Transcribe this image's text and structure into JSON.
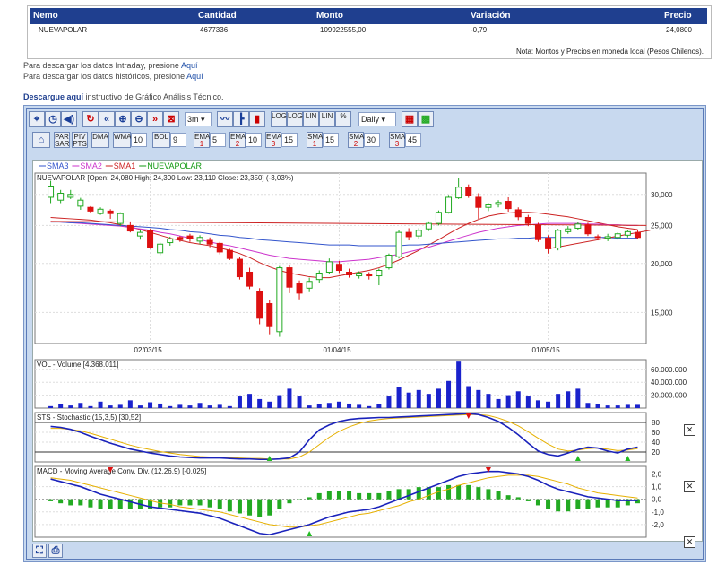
{
  "table": {
    "headers": [
      "Nemo",
      "Cantidad",
      "Monto",
      "Variación",
      "Precio"
    ],
    "row": [
      "NUEVAPOLAR",
      "4677336",
      "109922555,00",
      "-0,79",
      "24,0800"
    ],
    "note": "Nota: Montos y Precios en moneda local (Pesos Chilenos)."
  },
  "links": {
    "intraday_text": "Para descargar los datos Intraday, presione",
    "historic_text": "Para descargar los datos históricos, presione",
    "link_label": "Aquí",
    "technical_prefix": "Descargue aquí",
    "technical_text": "instructivo de Gráfico Análisis Técnico."
  },
  "toolbar": {
    "period": "3m",
    "interval": "Daily",
    "log1": "LOG",
    "log2": "LOG",
    "lin1": "LIN",
    "lin2": "LIN",
    "pct": "%"
  },
  "indicators": {
    "par": "PAR SAR",
    "piv": "PIV PTS",
    "dma": "DMA",
    "wma": "WMA",
    "wma_val": "10",
    "bol": "BOL",
    "bol_val": "9",
    "ema1": "EMA",
    "ema1_n": "1",
    "ema1_val": "5",
    "ema2": "EMA",
    "ema2_n": "2",
    "ema2_val": "10",
    "ema3": "EMA",
    "ema3_n": "3",
    "ema3_val": "15",
    "sma1": "SMA",
    "sma1_n": "1",
    "sma1_val": "15",
    "sma2": "SMA",
    "sma2_n": "2",
    "sma2_val": "30",
    "sma3": "SMA",
    "sma3_n": "3",
    "sma3_val": "45"
  },
  "legend": [
    {
      "label": "SMA3",
      "color": "#3355cc"
    },
    {
      "label": "SMA2",
      "color": "#cc33cc"
    },
    {
      "label": "SMA1",
      "color": "#cc2222"
    },
    {
      "label": "NUEVAPOLAR",
      "color": "#119911"
    }
  ],
  "price_info": "NUEVAPOLAR [Open: 24,080  High: 24,300  Low: 23,110  Close: 23,350] (-3,03%)",
  "volume_label": "VOL - Volume [4.368.011]",
  "stoch_label": "STS - Stochastic (15,3,5) [30,52]",
  "macd_label": "MACD - Moving Average Conv. Div. (12,26,9) [-0,025]",
  "colors": {
    "up": "#22aa22",
    "down": "#dd1111",
    "volume": "#1a22cc",
    "stoch": "#1a22bb",
    "signal": "#e6b000",
    "macd": "#1a22bb"
  },
  "chart_data": [
    {
      "type": "candlestick",
      "title": "NUEVAPOLAR",
      "x_ticks": [
        "02/03/15",
        "01/04/15",
        "01/05/15"
      ],
      "y_ticks": [
        "30,000",
        "25,000",
        "20,000",
        "15,000"
      ],
      "ylim": [
        12.5,
        34
      ],
      "scale": "log",
      "candles": [
        [
          29.5,
          31.5,
          32.5,
          28.5
        ],
        [
          29.0,
          30.2,
          30.8,
          28.5
        ],
        [
          29.5,
          30.0,
          30.8,
          29.2
        ],
        [
          28.0,
          29.0,
          29.4,
          27.4
        ],
        [
          27.8,
          27.2,
          28.0,
          26.9
        ],
        [
          26.8,
          27.5,
          27.8,
          26.6
        ],
        [
          27.2,
          26.8,
          27.5,
          26.0
        ],
        [
          25.3,
          26.8,
          27.0,
          24.9
        ],
        [
          25.0,
          24.2,
          25.6,
          24.0
        ],
        [
          23.5,
          24.0,
          24.3,
          23.0
        ],
        [
          24.3,
          22.0,
          24.5,
          21.8
        ],
        [
          21.3,
          22.4,
          22.6,
          21.0
        ],
        [
          22.6,
          23.1,
          23.4,
          22.2
        ],
        [
          23.3,
          23.0,
          23.5,
          22.7
        ],
        [
          23.5,
          23.1,
          23.8,
          22.7
        ],
        [
          22.8,
          23.3,
          23.6,
          22.4
        ],
        [
          22.9,
          22.4,
          23.3,
          22.0
        ],
        [
          22.5,
          21.4,
          22.7,
          21.1
        ],
        [
          21.6,
          20.6,
          21.8,
          20.4
        ],
        [
          20.5,
          18.5,
          20.8,
          18.2
        ],
        [
          19.0,
          17.5,
          19.5,
          17.2
        ],
        [
          17.0,
          14.5,
          17.3,
          14.0
        ],
        [
          15.8,
          13.8,
          16.1,
          13.2
        ],
        [
          13.4,
          19.5,
          19.7,
          13.0
        ],
        [
          19.5,
          17.4,
          19.8,
          16.8
        ],
        [
          17.8,
          16.8,
          18.1,
          16.2
        ],
        [
          17.3,
          18.0,
          18.4,
          16.9
        ],
        [
          18.2,
          18.9,
          19.2,
          17.8
        ],
        [
          19.0,
          20.2,
          20.6,
          18.8
        ],
        [
          19.9,
          19.2,
          20.3,
          18.9
        ],
        [
          19.0,
          18.7,
          19.4,
          18.4
        ],
        [
          18.6,
          18.9,
          19.1,
          18.3
        ],
        [
          18.8,
          18.6,
          19.0,
          18.2
        ],
        [
          18.6,
          19.2,
          19.4,
          17.6
        ],
        [
          19.5,
          21.0,
          21.2,
          19.3
        ],
        [
          20.8,
          24.0,
          24.4,
          20.6
        ],
        [
          24.0,
          23.4,
          24.6,
          22.9
        ],
        [
          23.5,
          24.3,
          24.6,
          23.1
        ],
        [
          24.5,
          25.3,
          25.6,
          24.2
        ],
        [
          25.3,
          27.0,
          27.3,
          25.0
        ],
        [
          27.0,
          29.5,
          29.9,
          26.8
        ],
        [
          29.4,
          31.3,
          33.0,
          29.2
        ],
        [
          31.2,
          29.8,
          31.8,
          29.4
        ],
        [
          29.5,
          27.8,
          30.2,
          26.0
        ],
        [
          27.8,
          28.2,
          28.5,
          27.2
        ],
        [
          28.3,
          28.6,
          29.0,
          27.8
        ],
        [
          28.8,
          27.6,
          29.5,
          27.1
        ],
        [
          27.4,
          26.3,
          27.8,
          25.8
        ],
        [
          26.2,
          25.3,
          26.6,
          24.9
        ],
        [
          25.0,
          23.0,
          25.4,
          22.7
        ],
        [
          23.2,
          21.8,
          23.6,
          21.2
        ],
        [
          21.9,
          24.3,
          24.5,
          21.6
        ],
        [
          24.1,
          24.5,
          24.9,
          23.8
        ],
        [
          24.6,
          25.2,
          25.5,
          24.3
        ],
        [
          25.1,
          23.8,
          25.4,
          23.5
        ],
        [
          23.4,
          23.3,
          23.7,
          22.9
        ],
        [
          23.2,
          23.4,
          23.8,
          22.8
        ],
        [
          23.3,
          23.8,
          24.0,
          23.0
        ],
        [
          23.6,
          24.1,
          24.4,
          23.3
        ],
        [
          24.0,
          23.3,
          24.3,
          23.1
        ]
      ],
      "series": [
        {
          "name": "SMA1",
          "values": [
            26.2,
            26.1,
            26.0,
            25.9,
            25.8,
            25.6,
            25.4,
            25.1,
            24.8,
            24.4,
            24.0,
            23.6,
            23.2,
            22.9,
            22.6,
            22.4,
            22.2,
            21.9,
            21.6,
            21.2,
            20.7,
            20.1,
            19.6,
            19.2,
            18.9,
            18.7,
            18.5,
            18.4,
            18.4,
            18.6,
            18.8,
            19.0,
            19.2,
            19.5,
            19.9,
            20.4,
            21.0,
            21.6,
            22.3,
            23.0,
            23.8,
            24.6,
            25.3,
            25.9,
            26.4,
            26.7,
            26.9,
            27.0,
            27.0,
            26.9,
            26.7,
            26.5,
            26.3,
            26.0,
            25.7,
            25.4,
            25.1,
            24.8,
            24.6,
            24.4
          ]
        },
        {
          "name": "SMA2",
          "values": [
            25.6,
            25.5,
            25.4,
            25.3,
            25.2,
            25.1,
            25.0,
            24.9,
            24.7,
            24.5,
            24.3,
            24.0,
            23.8,
            23.5,
            23.2,
            23.0,
            22.7,
            22.4,
            22.2,
            21.9,
            21.6,
            21.3,
            21.0,
            20.8,
            20.6,
            20.5,
            20.4,
            20.3,
            20.2,
            20.2,
            20.3,
            20.4,
            20.5,
            20.7,
            20.9,
            21.1,
            21.4,
            21.7,
            22.0,
            22.4,
            22.8,
            23.2,
            23.6,
            24.0,
            24.3,
            24.6,
            24.8,
            25.0,
            25.1,
            25.2,
            25.3,
            25.3,
            25.3,
            25.3,
            25.2,
            25.2,
            25.1,
            25.1,
            25.0,
            25.0
          ]
        },
        {
          "name": "SMA3",
          "values": [
            25.5,
            25.5,
            25.4,
            25.4,
            25.3,
            25.2,
            25.1,
            25.0,
            24.9,
            24.8,
            24.7,
            24.6,
            24.4,
            24.3,
            24.1,
            24.0,
            23.8,
            23.6,
            23.5,
            23.3,
            23.2,
            23.0,
            22.9,
            22.8,
            22.7,
            22.6,
            22.5,
            22.4,
            22.3,
            22.3,
            22.3,
            22.2,
            22.2,
            22.2,
            22.2,
            22.2,
            22.3,
            22.3,
            22.4,
            22.5,
            22.6,
            22.7,
            22.8,
            22.9,
            23.0,
            23.1,
            23.1,
            23.2,
            23.2,
            23.3,
            23.3,
            23.3,
            23.3,
            23.3,
            23.3,
            23.3,
            23.3,
            23.2,
            23.2,
            23.2
          ]
        }
      ]
    },
    {
      "type": "bar",
      "title": "VOL - Volume [4.368.011]",
      "y_ticks": [
        "60.000.000",
        "40.000.000",
        "20.000.000"
      ],
      "ylim": [
        0,
        75
      ],
      "values": [
        3,
        6,
        4,
        8,
        3,
        10,
        4,
        5,
        12,
        4,
        9,
        7,
        3,
        5,
        4,
        8,
        4,
        5,
        3,
        18,
        22,
        14,
        10,
        20,
        30,
        18,
        4,
        6,
        8,
        10,
        7,
        5,
        3,
        6,
        18,
        32,
        24,
        28,
        22,
        30,
        42,
        72,
        34,
        28,
        22,
        14,
        20,
        26,
        18,
        12,
        10,
        22,
        26,
        30,
        8,
        6,
        4,
        4,
        5,
        5
      ]
    },
    {
      "type": "line",
      "title": "STS - Stochastic (15,3,5) [30,52]",
      "y_ticks": [
        "80",
        "60",
        "40",
        "20"
      ],
      "ylim": [
        0,
        100
      ],
      "series": [
        {
          "name": "K",
          "values": [
            72,
            70,
            66,
            60,
            52,
            45,
            38,
            32,
            26,
            22,
            18,
            15,
            12,
            10,
            9,
            8,
            8,
            8,
            7,
            6,
            6,
            5,
            5,
            6,
            8,
            20,
            45,
            65,
            75,
            82,
            86,
            88,
            89,
            90,
            90,
            91,
            92,
            93,
            94,
            95,
            96,
            97,
            98,
            96,
            90,
            82,
            70,
            55,
            38,
            22,
            15,
            12,
            18,
            25,
            30,
            28,
            22,
            18,
            26,
            30
          ]
        },
        {
          "name": "Signal",
          "values": [
            68,
            68,
            66,
            63,
            58,
            52,
            46,
            40,
            34,
            29,
            25,
            21,
            18,
            15,
            13,
            11,
            10,
            9,
            9,
            8,
            7,
            7,
            6,
            6,
            6,
            10,
            20,
            35,
            50,
            62,
            71,
            78,
            83,
            86,
            88,
            89,
            90,
            91,
            92,
            93,
            94,
            95,
            96,
            96,
            94,
            89,
            82,
            73,
            61,
            48,
            36,
            26,
            22,
            24,
            27,
            28,
            26,
            23,
            24,
            27
          ]
        }
      ]
    },
    {
      "type": "line",
      "title": "MACD - Moving Average Conv. Div. (12,26,9) [-0,025]",
      "y_ticks": [
        "2,0",
        "1,0",
        "0,0",
        "-1,0",
        "-2,0"
      ],
      "ylim": [
        -3,
        2.6
      ],
      "series": [
        {
          "name": "MACD",
          "values": [
            1.6,
            1.4,
            1.2,
            1.0,
            0.7,
            0.4,
            0.2,
            0.0,
            -0.2,
            -0.4,
            -0.6,
            -0.7,
            -0.8,
            -0.9,
            -1.0,
            -1.1,
            -1.3,
            -1.5,
            -1.8,
            -2.1,
            -2.4,
            -2.7,
            -2.8,
            -2.6,
            -2.4,
            -2.2,
            -2.0,
            -1.7,
            -1.4,
            -1.2,
            -1.0,
            -0.9,
            -0.8,
            -0.6,
            -0.3,
            0.0,
            0.3,
            0.6,
            0.9,
            1.2,
            1.5,
            1.8,
            2.0,
            2.1,
            2.2,
            2.2,
            2.1,
            2.0,
            1.8,
            1.5,
            1.1,
            0.8,
            0.6,
            0.4,
            0.2,
            0.1,
            0.0,
            -0.1,
            -0.1,
            -0.1
          ]
        },
        {
          "name": "Signal",
          "values": [
            1.7,
            1.6,
            1.5,
            1.3,
            1.1,
            0.9,
            0.7,
            0.5,
            0.3,
            0.1,
            -0.1,
            -0.3,
            -0.4,
            -0.6,
            -0.7,
            -0.8,
            -0.9,
            -1.0,
            -1.2,
            -1.4,
            -1.6,
            -1.8,
            -2.0,
            -2.1,
            -2.2,
            -2.2,
            -2.1,
            -2.0,
            -1.8,
            -1.6,
            -1.4,
            -1.2,
            -1.1,
            -0.9,
            -0.7,
            -0.5,
            -0.2,
            0.0,
            0.3,
            0.6,
            0.8,
            1.1,
            1.3,
            1.5,
            1.7,
            1.8,
            1.9,
            1.9,
            1.9,
            1.8,
            1.6,
            1.4,
            1.2,
            0.9,
            0.7,
            0.5,
            0.4,
            0.3,
            0.2,
            0.1
          ]
        }
      ]
    }
  ]
}
